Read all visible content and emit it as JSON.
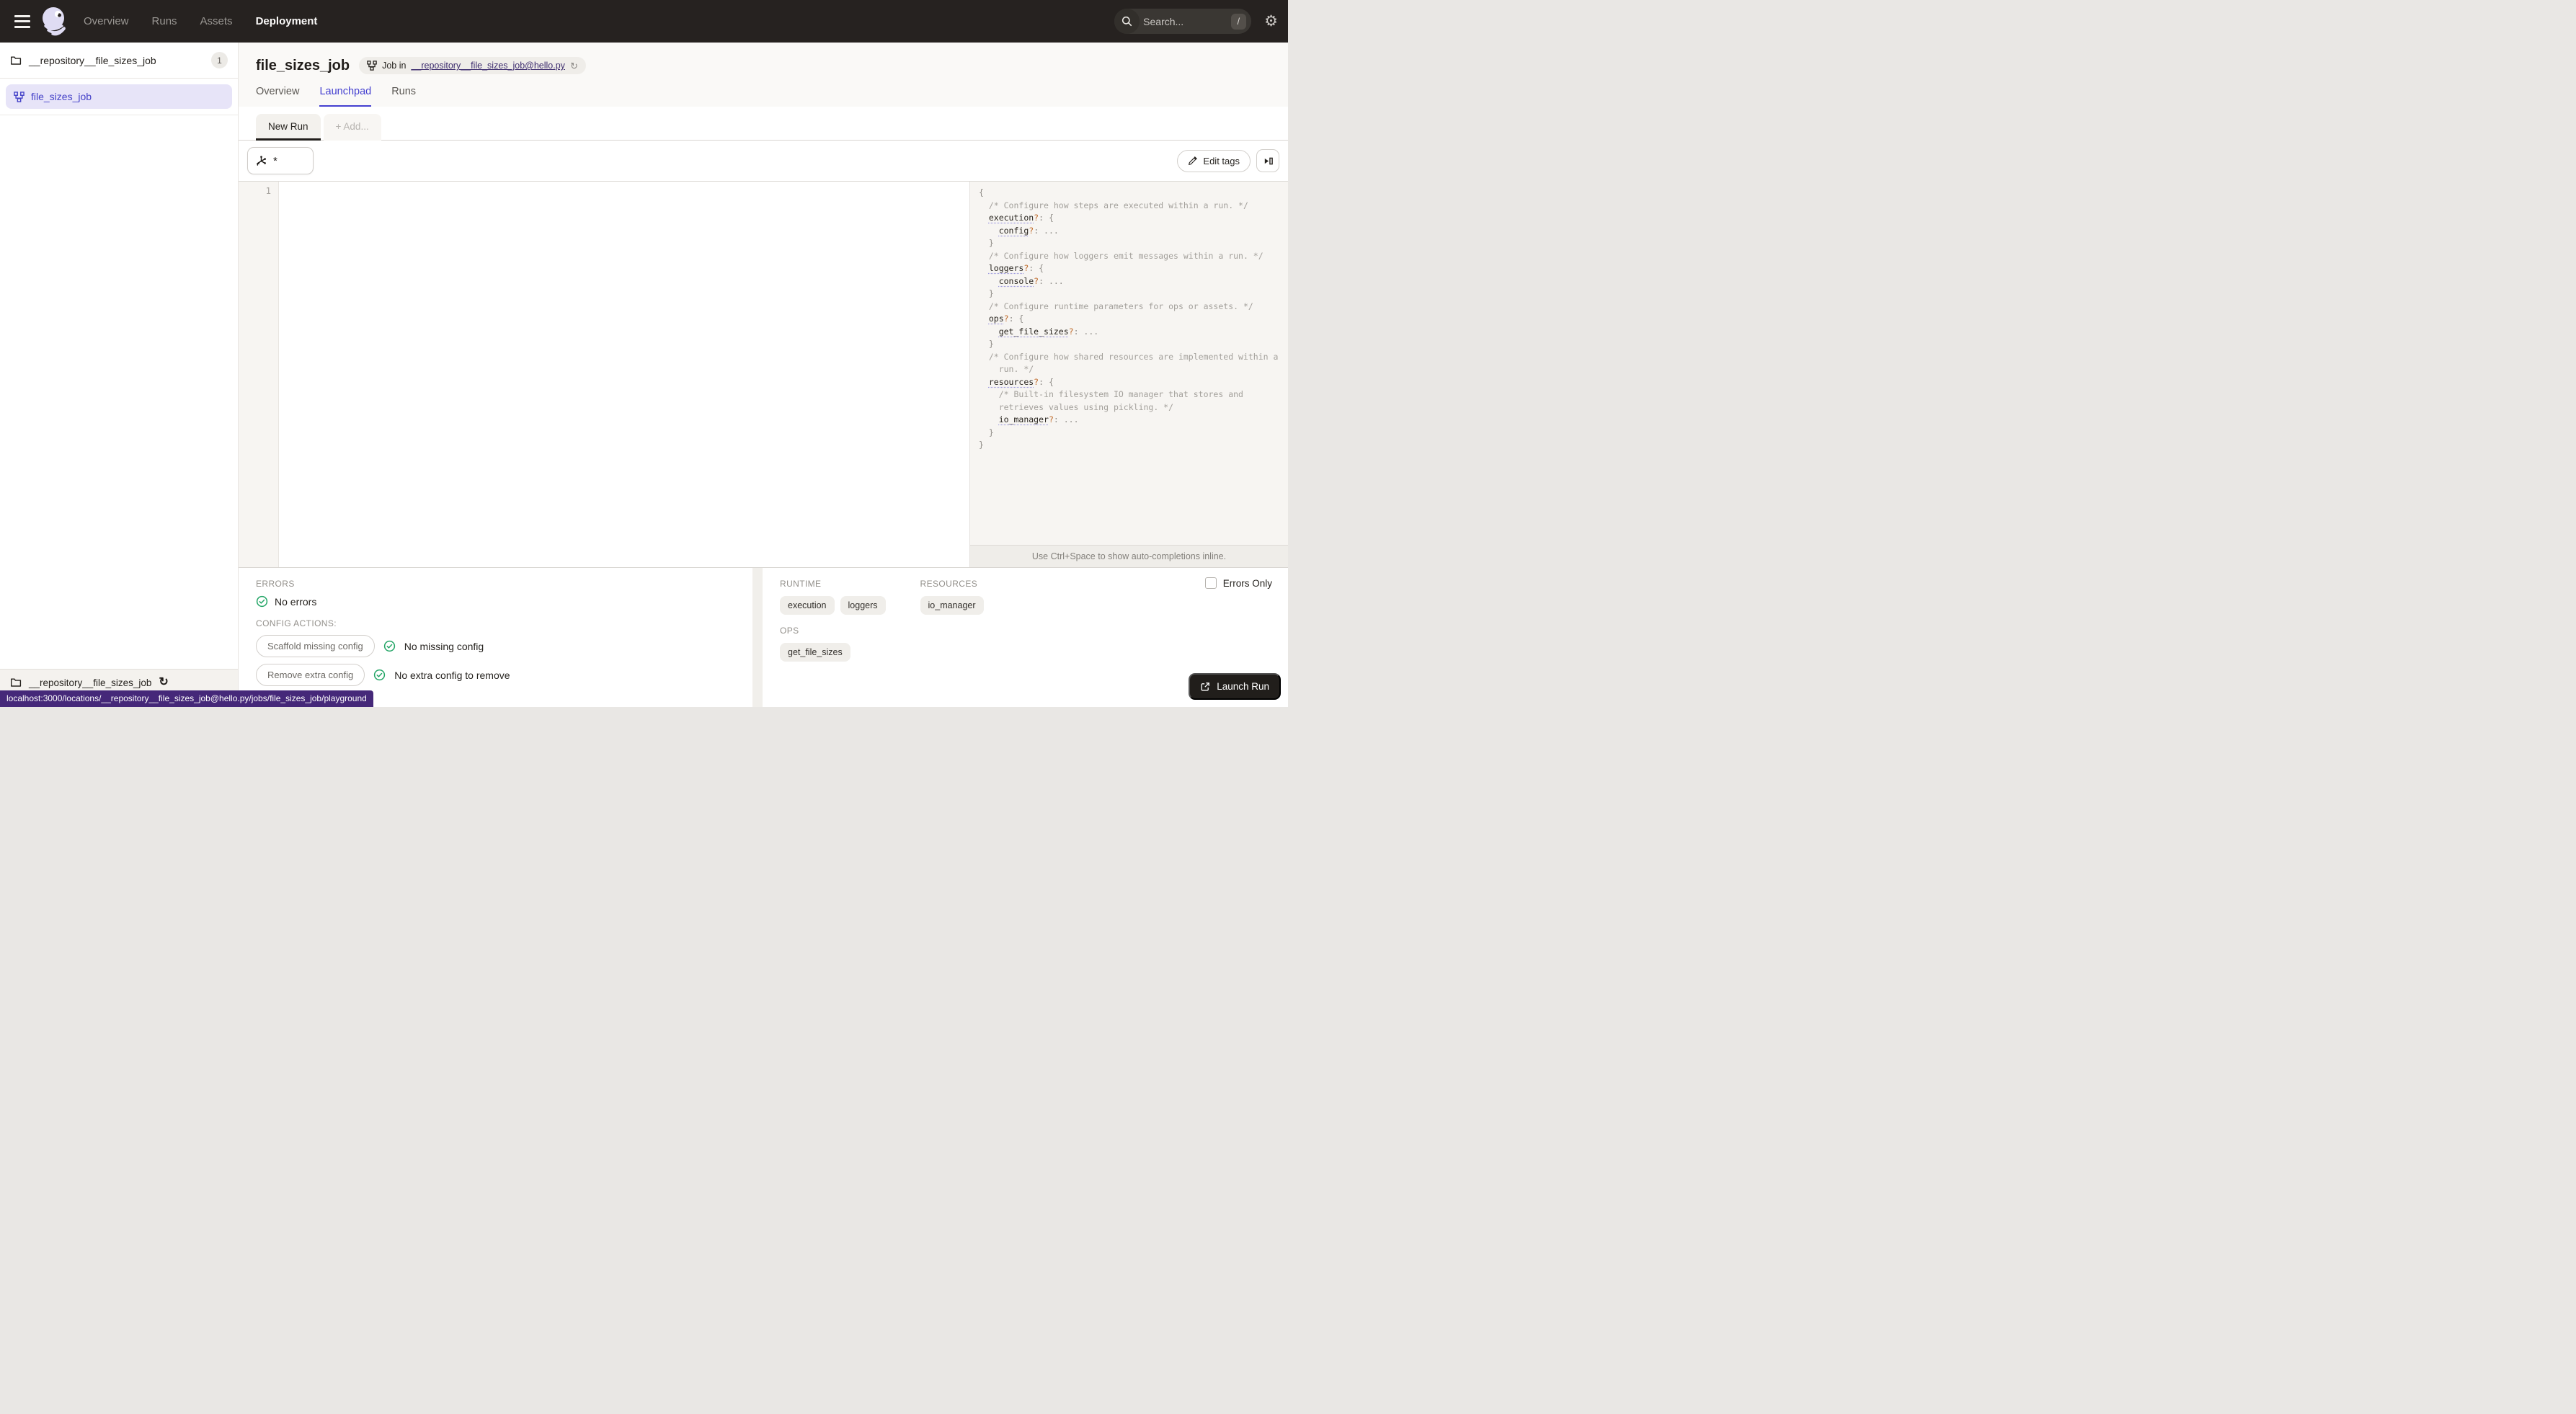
{
  "colors": {
    "accent_blue": "#4440d0",
    "selected_bg": "#e7e4f8",
    "green": "#23a566",
    "tooltip_purple": "#452879",
    "nav_bg": "#262220"
  },
  "topnav": {
    "links": [
      {
        "label": "Overview",
        "active": false
      },
      {
        "label": "Runs",
        "active": false
      },
      {
        "label": "Assets",
        "active": false
      },
      {
        "label": "Deployment",
        "active": true
      }
    ],
    "search": {
      "placeholder": "Search...",
      "shortcut": "/"
    }
  },
  "sidebar": {
    "repo": {
      "name": "__repository__file_sizes_job",
      "count": "1"
    },
    "job": {
      "name": "file_sizes_job"
    },
    "footer": {
      "name": "__repository__file_sizes_job"
    }
  },
  "statusbar": {
    "url": "localhost:3000/locations/__repository__file_sizes_job@hello.py/jobs/file_sizes_job/playground"
  },
  "header": {
    "title": "file_sizes_job",
    "badge": {
      "prefix": "Job in",
      "link": "__repository__file_sizes_job@hello.py"
    }
  },
  "tabs": [
    {
      "label": "Overview",
      "active": false
    },
    {
      "label": "Launchpad",
      "active": true
    },
    {
      "label": "Runs",
      "active": false
    }
  ],
  "launchpad": {
    "run_tabs": [
      {
        "label": "New Run",
        "active": true
      },
      {
        "label": "+ Add...",
        "active": false
      }
    ],
    "op_selector": {
      "value": "*"
    },
    "edit_tags": "Edit tags",
    "editor": {
      "line_number": "1"
    },
    "schema": {
      "hint": "Use Ctrl+Space to show auto-completions inline.",
      "lines": [
        [
          {
            "t": "{",
            "k": "p"
          }
        ],
        [
          {
            "t": "  ",
            "k": "p"
          },
          {
            "t": "/* Configure how steps are executed within a run. */",
            "k": "c"
          }
        ],
        [
          {
            "t": "  ",
            "k": "p"
          },
          {
            "t": "execution",
            "k": "k"
          },
          {
            "t": "?",
            "k": "q"
          },
          {
            "t": ": {",
            "k": "p"
          }
        ],
        [
          {
            "t": "    ",
            "k": "p"
          },
          {
            "t": "config",
            "k": "k"
          },
          {
            "t": "?",
            "k": "q"
          },
          {
            "t": ": ...",
            "k": "p"
          }
        ],
        [
          {
            "t": "  }",
            "k": "p"
          }
        ],
        [
          {
            "t": "  ",
            "k": "p"
          },
          {
            "t": "/* Configure how loggers emit messages within a run. */",
            "k": "c"
          }
        ],
        [
          {
            "t": "  ",
            "k": "p"
          },
          {
            "t": "loggers",
            "k": "k"
          },
          {
            "t": "?",
            "k": "q"
          },
          {
            "t": ": {",
            "k": "p"
          }
        ],
        [
          {
            "t": "    ",
            "k": "p"
          },
          {
            "t": "console",
            "k": "k"
          },
          {
            "t": "?",
            "k": "q"
          },
          {
            "t": ": ...",
            "k": "p"
          }
        ],
        [
          {
            "t": "  }",
            "k": "p"
          }
        ],
        [
          {
            "t": "  ",
            "k": "p"
          },
          {
            "t": "/* Configure runtime parameters for ops or assets. */",
            "k": "c"
          }
        ],
        [
          {
            "t": "  ",
            "k": "p"
          },
          {
            "t": "ops",
            "k": "k"
          },
          {
            "t": "?",
            "k": "q"
          },
          {
            "t": ": {",
            "k": "p"
          }
        ],
        [
          {
            "t": "    ",
            "k": "p"
          },
          {
            "t": "get_file_sizes",
            "k": "k"
          },
          {
            "t": "?",
            "k": "q"
          },
          {
            "t": ": ...",
            "k": "p"
          }
        ],
        [
          {
            "t": "  }",
            "k": "p"
          }
        ],
        [
          {
            "t": "  ",
            "k": "p"
          },
          {
            "t": "/* Configure how shared resources are implemented within a",
            "k": "c"
          }
        ],
        [
          {
            "t": "    ",
            "k": "p"
          },
          {
            "t": "run. */",
            "k": "c"
          }
        ],
        [
          {
            "t": "  ",
            "k": "p"
          },
          {
            "t": "resources",
            "k": "k"
          },
          {
            "t": "?",
            "k": "q"
          },
          {
            "t": ": {",
            "k": "p"
          }
        ],
        [
          {
            "t": "    ",
            "k": "p"
          },
          {
            "t": "/* Built-in filesystem IO manager that stores and",
            "k": "c"
          }
        ],
        [
          {
            "t": "    ",
            "k": "p"
          },
          {
            "t": "retrieves values using pickling. */",
            "k": "c"
          }
        ],
        [
          {
            "t": "    ",
            "k": "p"
          },
          {
            "t": "io_manager",
            "k": "k"
          },
          {
            "t": "?",
            "k": "q"
          },
          {
            "t": ": ...",
            "k": "p"
          }
        ],
        [
          {
            "t": "  }",
            "k": "p"
          }
        ],
        [
          {
            "t": "}",
            "k": "p"
          }
        ]
      ]
    },
    "errors": {
      "heading": "ERRORS",
      "status": "No errors"
    },
    "config_actions": {
      "heading": "CONFIG ACTIONS:",
      "actions": [
        {
          "button": "Scaffold missing config",
          "status": "No missing config"
        },
        {
          "button": "Remove extra config",
          "status": "No extra config to remove"
        }
      ]
    },
    "summary": {
      "runtime": {
        "heading": "RUNTIME",
        "pills": [
          "execution",
          "loggers"
        ]
      },
      "resources": {
        "heading": "RESOURCES",
        "pills": [
          "io_manager"
        ]
      },
      "ops": {
        "heading": "OPS",
        "pills": [
          "get_file_sizes"
        ]
      },
      "errors_only": "Errors Only",
      "launch": "Launch Run"
    }
  }
}
